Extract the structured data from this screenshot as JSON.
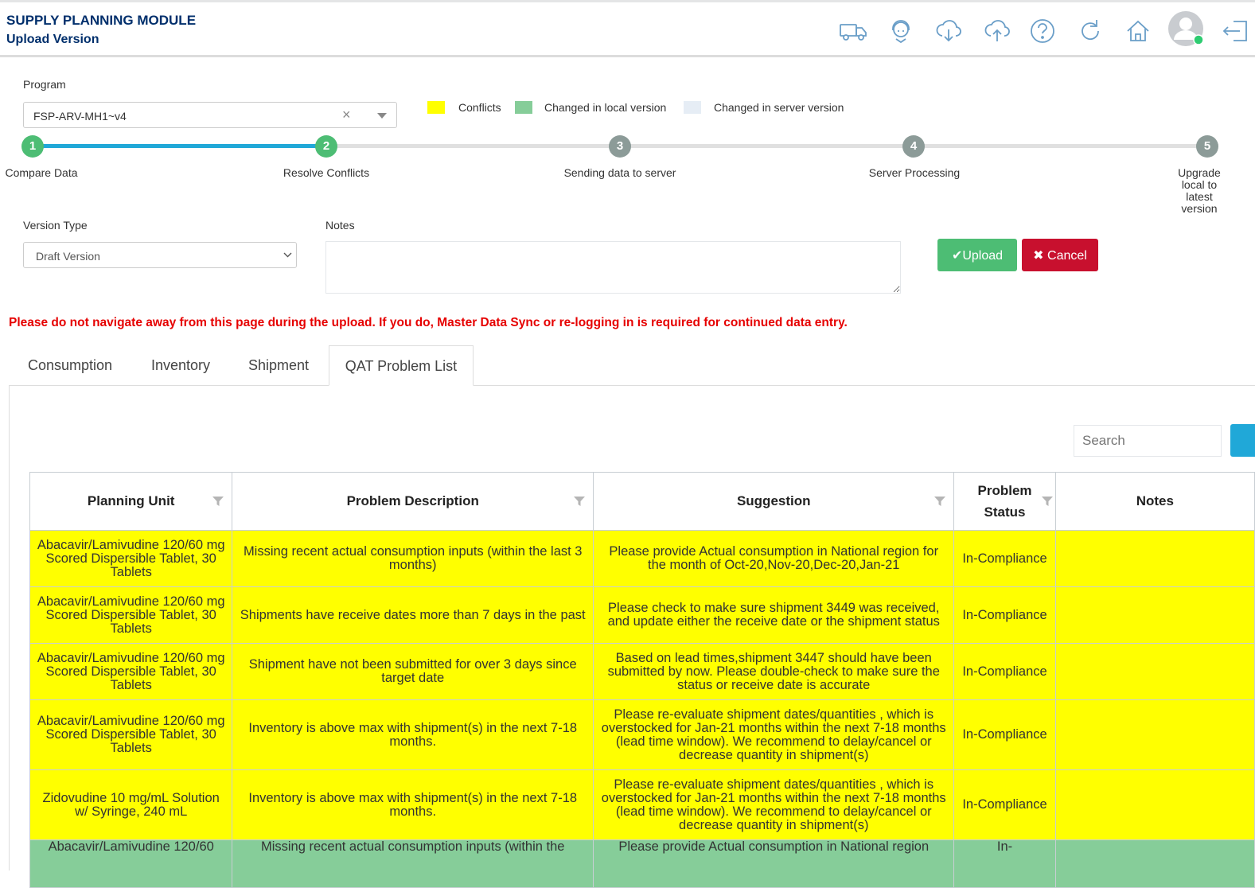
{
  "header": {
    "title": "SUPPLY PLANNING MODULE",
    "subtitle": "Upload Version",
    "icons": [
      "truck-icon",
      "support-agent-icon",
      "cloud-download-icon",
      "cloud-upload-icon",
      "help-icon",
      "refresh-icon",
      "home-icon",
      "user-avatar-icon",
      "logout-icon"
    ]
  },
  "program": {
    "label": "Program",
    "value": "FSP-ARV-MH1~v4",
    "clear": "×"
  },
  "legend": [
    {
      "label": "Conflicts",
      "color": "#ffff00"
    },
    {
      "label": "Changed in local version",
      "color": "#86cd99"
    },
    {
      "label": "Changed in server version",
      "color": "#e6edf5"
    }
  ],
  "stepper": {
    "current": 2,
    "steps": [
      {
        "num": "1",
        "label": "Compare Data"
      },
      {
        "num": "2",
        "label": "Resolve Conflicts"
      },
      {
        "num": "3",
        "label": "Sending data to server"
      },
      {
        "num": "4",
        "label": "Server Processing"
      },
      {
        "num": "5",
        "label": "Upgrade local to latest version"
      }
    ]
  },
  "version_type": {
    "label": "Version Type",
    "value": "Draft Version"
  },
  "notes": {
    "label": "Notes",
    "value": ""
  },
  "buttons": {
    "upload": "✔Upload",
    "cancel": "✖ Cancel"
  },
  "warning": "Please do not navigate away from this page during the upload. If you do, Master Data Sync or re-logging in is required for continued data entry.",
  "tabs": [
    "Consumption",
    "Inventory",
    "Shipment",
    "QAT Problem List"
  ],
  "active_tab": "QAT Problem List",
  "search": {
    "placeholder": "Search"
  },
  "table": {
    "columns": [
      "Planning Unit",
      "Problem Description",
      "Suggestion",
      "Problem Status",
      "Notes"
    ],
    "rows": [
      {
        "planning_unit": "Abacavir/Lamivudine 120/60 mg Scored Dispersible Tablet, 30 Tablets",
        "description": "Missing recent actual consumption inputs (within the last 3 months)",
        "suggestion": "Please provide Actual consumption in National region for the month of Oct-20,Nov-20,Dec-20,Jan-21",
        "status": "In-Compliance",
        "notes": "",
        "highlight": "conflict"
      },
      {
        "planning_unit": "Abacavir/Lamivudine 120/60 mg Scored Dispersible Tablet, 30 Tablets",
        "description": "Shipments have receive dates more than 7 days in the past",
        "suggestion": "Please check to make sure shipment 3449 was received, and update either the receive date or the shipment status",
        "status": "In-Compliance",
        "notes": "",
        "highlight": "conflict"
      },
      {
        "planning_unit": "Abacavir/Lamivudine 120/60 mg Scored Dispersible Tablet, 30 Tablets",
        "description": "Shipment have not been submitted for over 3 days since target date",
        "suggestion": "Based on lead times,shipment 3447 should have been submitted by now. Please double-check to make sure the status or receive date is accurate",
        "status": "In-Compliance",
        "notes": "",
        "highlight": "conflict"
      },
      {
        "planning_unit": "Abacavir/Lamivudine 120/60 mg Scored Dispersible Tablet, 30 Tablets",
        "description": "Inventory is above max with shipment(s) in the next 7-18 months.",
        "suggestion": "Please re-evaluate shipment dates/quantities , which is overstocked for Jan-21 months within the next 7-18 months (lead time window). We recommend to delay/cancel or decrease quantity in shipment(s)",
        "status": "In-Compliance",
        "notes": "",
        "highlight": "conflict"
      },
      {
        "planning_unit": "Zidovudine 10 mg/mL Solution w/ Syringe, 240 mL",
        "description": "Inventory is above max with shipment(s) in the next 7-18 months.",
        "suggestion": "Please re-evaluate shipment dates/quantities , which is overstocked for Jan-21 months within the next 7-18 months (lead time window). We recommend to delay/cancel or decrease quantity in shipment(s)",
        "status": "In-Compliance",
        "notes": "",
        "highlight": "conflict"
      },
      {
        "planning_unit": "Abacavir/Lamivudine 120/60",
        "description": "Missing recent actual consumption inputs (within the",
        "suggestion": "Please provide Actual consumption in National region",
        "status": "In-",
        "notes": "",
        "highlight": "local"
      }
    ]
  },
  "colors": {
    "step_done": "#4dbd74",
    "step_pending": "#8c9b98",
    "track_active": "#20a8d8",
    "track_idle": "#e0e0e0",
    "upload": "#4dbd74",
    "cancel": "#c8102e",
    "title": "#002f6c",
    "warning": "#e60000"
  }
}
